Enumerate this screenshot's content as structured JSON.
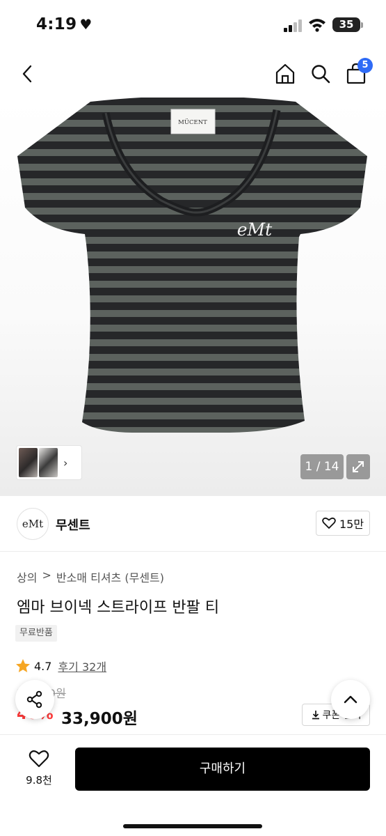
{
  "status_bar": {
    "time": "4:19",
    "battery": "35"
  },
  "nav": {
    "cart_count": "5"
  },
  "gallery": {
    "counter": "1 / 14"
  },
  "product_image": {
    "label_text": "MÜCENT",
    "logo_text": "eMt"
  },
  "brand": {
    "logo_text": "eMt",
    "name": "무센트",
    "likes": "15만"
  },
  "breadcrumb": {
    "level1": "상의",
    "separator": ">",
    "level2": "반소매 티셔츠 (무센트)"
  },
  "product": {
    "title": "엠마 브이넥 스트라이프 반팔 티",
    "tag": "무료반품",
    "rating": "4.7",
    "reviews": "후기 32개",
    "original_price": "56,500원",
    "discount": "40%",
    "price": "33,900원",
    "coupon_label": "쿠폰 받기"
  },
  "bottom": {
    "wish_count": "9.8천",
    "buy_label": "구매하기"
  },
  "colors": {
    "accent_blue": "#2f6bf6",
    "discount_red": "#ff3a3a",
    "star": "#f6a623",
    "stripe_dark": "#262729",
    "stripe_grey": "#5c625e"
  },
  "icons": [
    "back-arrow-icon",
    "home-icon",
    "search-icon",
    "shopping-bag-icon",
    "expand-icon",
    "heart-icon",
    "star-icon",
    "share-icon",
    "chevron-up-icon",
    "download-icon"
  ]
}
